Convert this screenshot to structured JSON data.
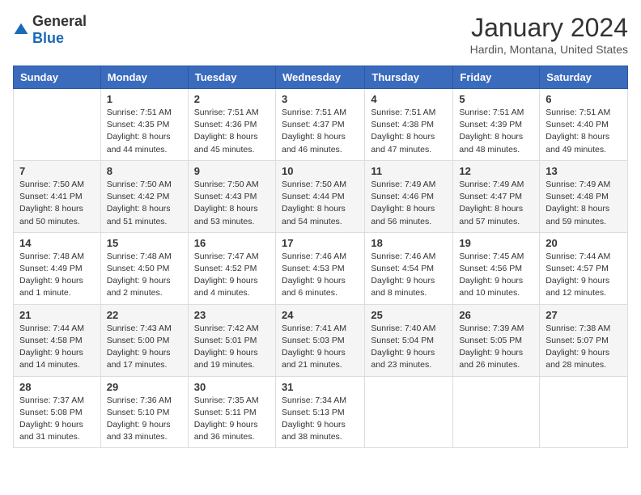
{
  "header": {
    "logo": {
      "general": "General",
      "blue": "Blue"
    },
    "title": "January 2024",
    "location": "Hardin, Montana, United States"
  },
  "weekdays": [
    "Sunday",
    "Monday",
    "Tuesday",
    "Wednesday",
    "Thursday",
    "Friday",
    "Saturday"
  ],
  "weeks": [
    [
      {
        "day": "",
        "info": ""
      },
      {
        "day": "1",
        "info": "Sunrise: 7:51 AM\nSunset: 4:35 PM\nDaylight: 8 hours\nand 44 minutes."
      },
      {
        "day": "2",
        "info": "Sunrise: 7:51 AM\nSunset: 4:36 PM\nDaylight: 8 hours\nand 45 minutes."
      },
      {
        "day": "3",
        "info": "Sunrise: 7:51 AM\nSunset: 4:37 PM\nDaylight: 8 hours\nand 46 minutes."
      },
      {
        "day": "4",
        "info": "Sunrise: 7:51 AM\nSunset: 4:38 PM\nDaylight: 8 hours\nand 47 minutes."
      },
      {
        "day": "5",
        "info": "Sunrise: 7:51 AM\nSunset: 4:39 PM\nDaylight: 8 hours\nand 48 minutes."
      },
      {
        "day": "6",
        "info": "Sunrise: 7:51 AM\nSunset: 4:40 PM\nDaylight: 8 hours\nand 49 minutes."
      }
    ],
    [
      {
        "day": "7",
        "info": "Sunrise: 7:50 AM\nSunset: 4:41 PM\nDaylight: 8 hours\nand 50 minutes."
      },
      {
        "day": "8",
        "info": "Sunrise: 7:50 AM\nSunset: 4:42 PM\nDaylight: 8 hours\nand 51 minutes."
      },
      {
        "day": "9",
        "info": "Sunrise: 7:50 AM\nSunset: 4:43 PM\nDaylight: 8 hours\nand 53 minutes."
      },
      {
        "day": "10",
        "info": "Sunrise: 7:50 AM\nSunset: 4:44 PM\nDaylight: 8 hours\nand 54 minutes."
      },
      {
        "day": "11",
        "info": "Sunrise: 7:49 AM\nSunset: 4:46 PM\nDaylight: 8 hours\nand 56 minutes."
      },
      {
        "day": "12",
        "info": "Sunrise: 7:49 AM\nSunset: 4:47 PM\nDaylight: 8 hours\nand 57 minutes."
      },
      {
        "day": "13",
        "info": "Sunrise: 7:49 AM\nSunset: 4:48 PM\nDaylight: 8 hours\nand 59 minutes."
      }
    ],
    [
      {
        "day": "14",
        "info": "Sunrise: 7:48 AM\nSunset: 4:49 PM\nDaylight: 9 hours\nand 1 minute."
      },
      {
        "day": "15",
        "info": "Sunrise: 7:48 AM\nSunset: 4:50 PM\nDaylight: 9 hours\nand 2 minutes."
      },
      {
        "day": "16",
        "info": "Sunrise: 7:47 AM\nSunset: 4:52 PM\nDaylight: 9 hours\nand 4 minutes."
      },
      {
        "day": "17",
        "info": "Sunrise: 7:46 AM\nSunset: 4:53 PM\nDaylight: 9 hours\nand 6 minutes."
      },
      {
        "day": "18",
        "info": "Sunrise: 7:46 AM\nSunset: 4:54 PM\nDaylight: 9 hours\nand 8 minutes."
      },
      {
        "day": "19",
        "info": "Sunrise: 7:45 AM\nSunset: 4:56 PM\nDaylight: 9 hours\nand 10 minutes."
      },
      {
        "day": "20",
        "info": "Sunrise: 7:44 AM\nSunset: 4:57 PM\nDaylight: 9 hours\nand 12 minutes."
      }
    ],
    [
      {
        "day": "21",
        "info": "Sunrise: 7:44 AM\nSunset: 4:58 PM\nDaylight: 9 hours\nand 14 minutes."
      },
      {
        "day": "22",
        "info": "Sunrise: 7:43 AM\nSunset: 5:00 PM\nDaylight: 9 hours\nand 17 minutes."
      },
      {
        "day": "23",
        "info": "Sunrise: 7:42 AM\nSunset: 5:01 PM\nDaylight: 9 hours\nand 19 minutes."
      },
      {
        "day": "24",
        "info": "Sunrise: 7:41 AM\nSunset: 5:03 PM\nDaylight: 9 hours\nand 21 minutes."
      },
      {
        "day": "25",
        "info": "Sunrise: 7:40 AM\nSunset: 5:04 PM\nDaylight: 9 hours\nand 23 minutes."
      },
      {
        "day": "26",
        "info": "Sunrise: 7:39 AM\nSunset: 5:05 PM\nDaylight: 9 hours\nand 26 minutes."
      },
      {
        "day": "27",
        "info": "Sunrise: 7:38 AM\nSunset: 5:07 PM\nDaylight: 9 hours\nand 28 minutes."
      }
    ],
    [
      {
        "day": "28",
        "info": "Sunrise: 7:37 AM\nSunset: 5:08 PM\nDaylight: 9 hours\nand 31 minutes."
      },
      {
        "day": "29",
        "info": "Sunrise: 7:36 AM\nSunset: 5:10 PM\nDaylight: 9 hours\nand 33 minutes."
      },
      {
        "day": "30",
        "info": "Sunrise: 7:35 AM\nSunset: 5:11 PM\nDaylight: 9 hours\nand 36 minutes."
      },
      {
        "day": "31",
        "info": "Sunrise: 7:34 AM\nSunset: 5:13 PM\nDaylight: 9 hours\nand 38 minutes."
      },
      {
        "day": "",
        "info": ""
      },
      {
        "day": "",
        "info": ""
      },
      {
        "day": "",
        "info": ""
      }
    ]
  ]
}
